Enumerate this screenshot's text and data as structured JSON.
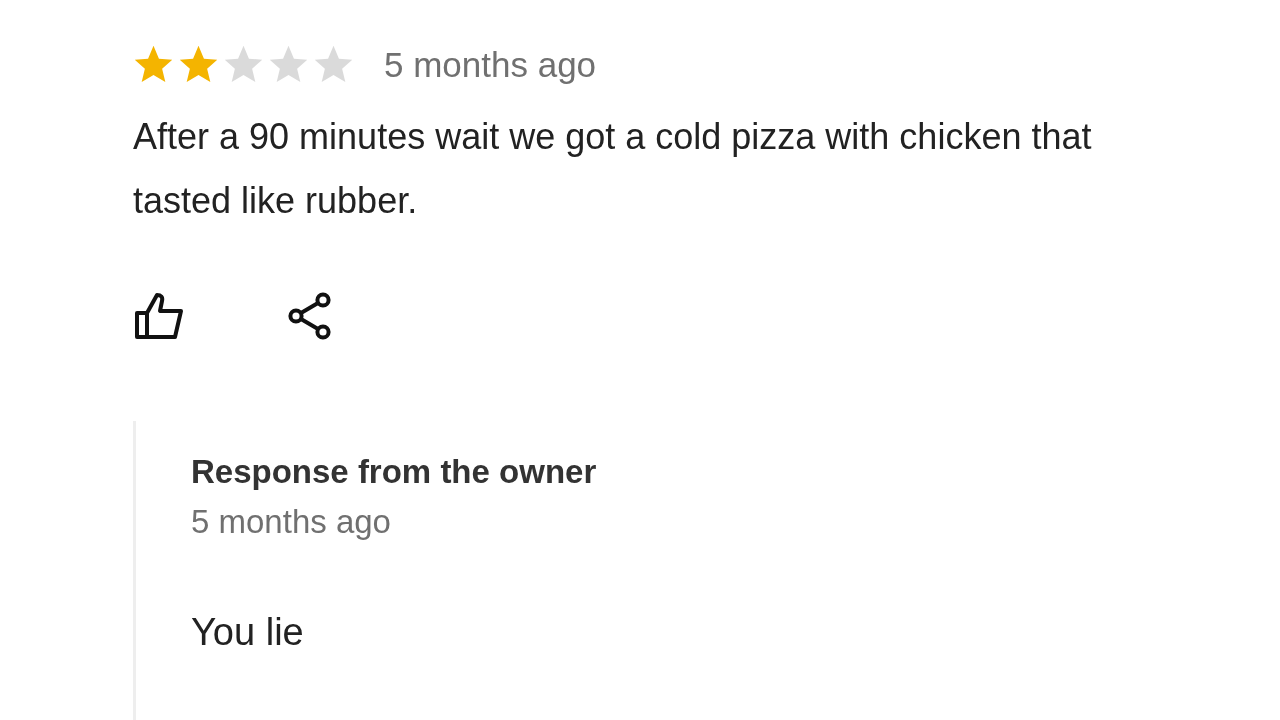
{
  "review": {
    "stars": 2,
    "time": "5 months ago",
    "text": "After a 90 minutes wait we got a cold pizza with chicken that tasted like rubber."
  },
  "response": {
    "title": "Response from the owner",
    "time": "5 months ago",
    "text": "You lie"
  }
}
